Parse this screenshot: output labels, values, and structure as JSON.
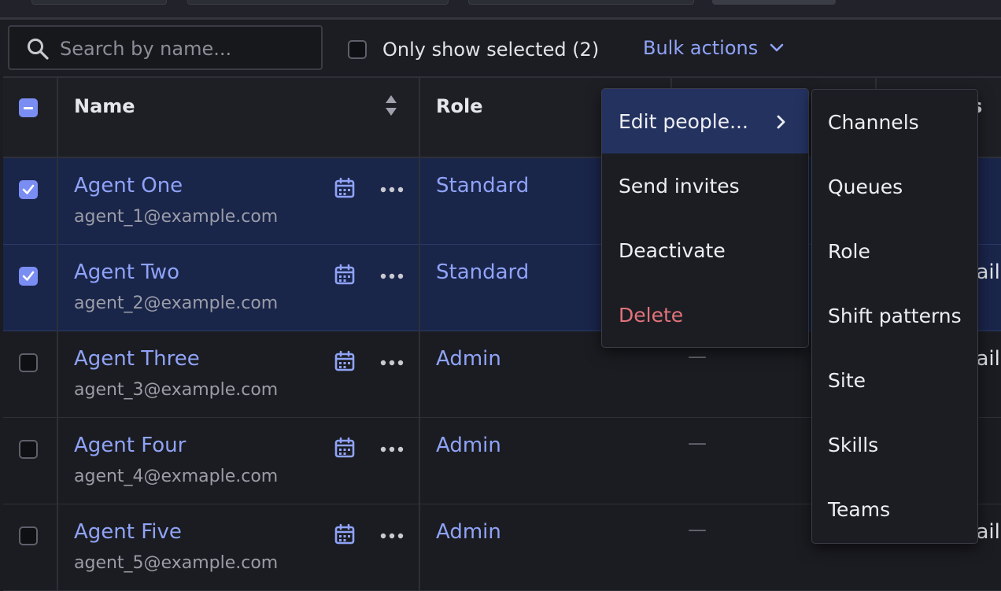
{
  "search": {
    "placeholder": "Search by name...",
    "value": ""
  },
  "filter": {
    "only_selected_label": "Only show selected (2)"
  },
  "bulk_actions": {
    "label": "Bulk actions"
  },
  "table": {
    "headers": {
      "name": "Name",
      "role": "Role",
      "partial_right": "s"
    },
    "rows": [
      {
        "name": "Agent One",
        "email": "agent_1@example.com",
        "role": "Standard",
        "selected": true,
        "dash": "",
        "right": ""
      },
      {
        "name": "Agent Two",
        "email": "agent_2@example.com",
        "role": "Standard",
        "selected": true,
        "dash": "",
        "right": "nail"
      },
      {
        "name": "Agent Three",
        "email": "agent_3@example.com",
        "role": "Admin",
        "selected": false,
        "dash": "—",
        "right": "nail"
      },
      {
        "name": "Agent Four",
        "email": "agent_4@exmaple.com",
        "role": "Admin",
        "selected": false,
        "dash": "—",
        "right": ""
      },
      {
        "name": "Agent Five",
        "email": "agent_5@example.com",
        "role": "Admin",
        "selected": false,
        "dash": "—",
        "right": "nail"
      }
    ]
  },
  "bulk_menu": {
    "items": [
      {
        "label": "Edit people...",
        "active": true,
        "danger": false,
        "has_submenu": true
      },
      {
        "label": "Send invites",
        "active": false,
        "danger": false,
        "has_submenu": false
      },
      {
        "label": "Deactivate",
        "active": false,
        "danger": false,
        "has_submenu": false
      },
      {
        "label": "Delete",
        "active": false,
        "danger": true,
        "has_submenu": false
      }
    ]
  },
  "edit_submenu": {
    "items": [
      "Channels",
      "Queues",
      "Role",
      "Shift patterns",
      "Site",
      "Skills",
      "Teams"
    ]
  },
  "colors": {
    "accent": "#8fa3f8",
    "selected_row": "#1a254a",
    "danger": "#e2737b",
    "background": "#1b1c21"
  }
}
